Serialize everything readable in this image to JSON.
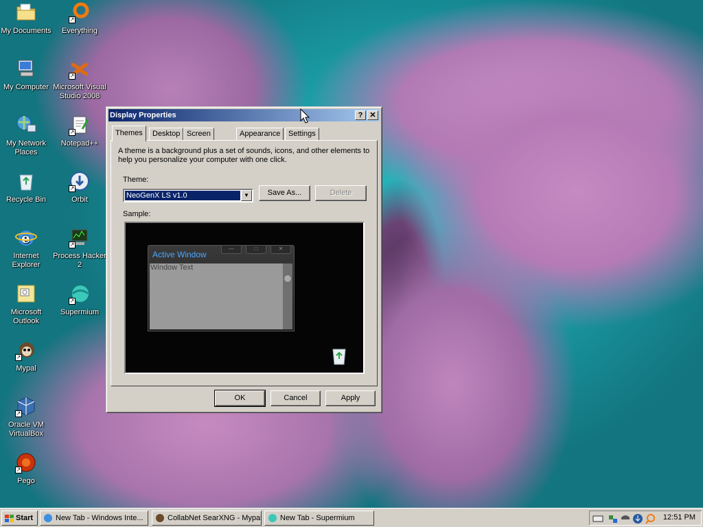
{
  "desktop": {
    "icons": [
      {
        "label": "My Documents",
        "icon": "folder-documents-icon"
      },
      {
        "label": "Everything",
        "icon": "everything-search-icon"
      },
      {
        "label": "My Computer",
        "icon": "computer-icon"
      },
      {
        "label": "Microsoft Visual Studio 2008",
        "icon": "visual-studio-icon"
      },
      {
        "label": "My Network Places",
        "icon": "network-places-icon"
      },
      {
        "label": "Notepad++",
        "icon": "notepadpp-icon"
      },
      {
        "label": "Recycle Bin",
        "icon": "recycle-bin-icon"
      },
      {
        "label": "Orbit",
        "icon": "orbit-download-icon"
      },
      {
        "label": "Internet Explorer",
        "icon": "internet-explorer-icon"
      },
      {
        "label": "Process Hacker 2",
        "icon": "process-hacker-icon"
      },
      {
        "label": "Microsoft Outlook",
        "icon": "outlook-icon"
      },
      {
        "label": "Supermium",
        "icon": "supermium-icon"
      },
      {
        "label": "Mypal",
        "icon": "mypal-icon"
      },
      {
        "label": "Oracle VM VirtualBox",
        "icon": "virtualbox-icon"
      },
      {
        "label": "Pego",
        "icon": "pego-icon"
      }
    ]
  },
  "dialog": {
    "title": "Display Properties",
    "help_button": "?",
    "close_button": "✕",
    "tabs": [
      "Themes",
      "Desktop",
      "Screen Saver",
      "Appearance",
      "Settings"
    ],
    "active_tab": "Themes",
    "description": "A theme is a background plus a set of sounds, icons, and other elements to help you personalize your computer with one click.",
    "theme_label": "Theme:",
    "theme_value": "NeoGenX LS v1.0",
    "save_as": "Save As...",
    "delete": "Delete",
    "sample_label": "Sample:",
    "sample": {
      "window_title": "Active Window",
      "window_text": "Window Text"
    },
    "ok": "OK",
    "cancel": "Cancel",
    "apply": "Apply"
  },
  "taskbar": {
    "start": "Start",
    "tasks": [
      {
        "label": "New Tab - Windows Inte...",
        "icon": "internet-explorer-icon"
      },
      {
        "label": "CollabNet SearXNG - Mypal",
        "icon": "mypal-icon"
      },
      {
        "label": "New Tab - Supermium",
        "icon": "supermium-icon"
      }
    ],
    "clock": "12:51 PM"
  }
}
